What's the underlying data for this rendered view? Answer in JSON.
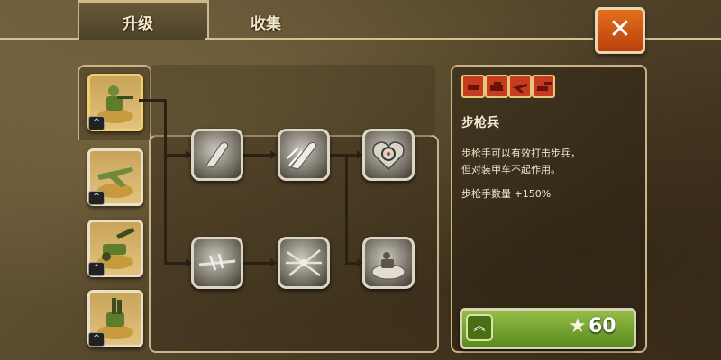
{
  "tabs": [
    {
      "label": "升级"
    },
    {
      "label": "收集"
    }
  ],
  "close": {
    "glyph": "✕"
  },
  "units": [
    {
      "icon": "rifleman-icon",
      "level_glyph": "^"
    },
    {
      "icon": "plane-icon",
      "level_glyph": "^"
    },
    {
      "icon": "cannon-icon",
      "level_glyph": "^"
    },
    {
      "icon": "antiair-gun-icon",
      "level_glyph": "^"
    }
  ],
  "upgrades": [
    {
      "icon": "bullet-icon"
    },
    {
      "icon": "fast-bullet-icon"
    },
    {
      "icon": "heart-target-icon"
    },
    {
      "icon": "barbed-wire-icon"
    },
    {
      "icon": "tangled-wire-icon"
    },
    {
      "icon": "soldier-bunker-icon"
    }
  ],
  "detail": {
    "title": "步枪兵",
    "desc1": "步枪手可以有效打击步兵，",
    "desc2": "但对装甲车不起作用。",
    "desc3": "步枪手数量 +150%"
  },
  "upgrade_button": {
    "chevron": "︽",
    "star": "★",
    "cost": "60"
  },
  "colors": {
    "accent": "#c63c1e",
    "button_green": "#7aa933",
    "close_orange": "#d8601a"
  }
}
